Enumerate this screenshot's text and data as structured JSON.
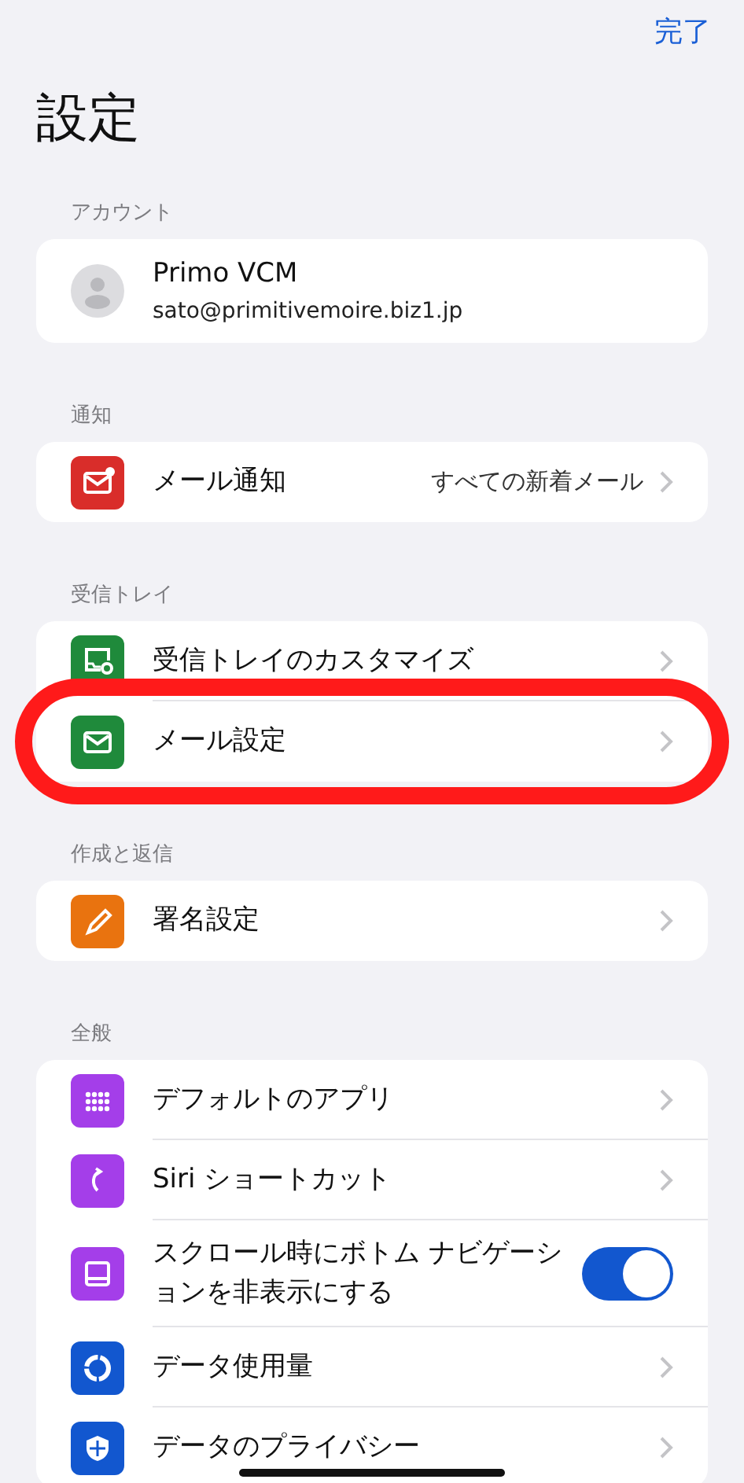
{
  "done_button": "完了",
  "title": "設定",
  "account": {
    "header": "アカウント",
    "name": "Primo VCM",
    "email": "sato@primitivemoire.biz1.jp"
  },
  "sections": [
    {
      "header": "通知",
      "rows": [
        {
          "kind": "link",
          "color": "#d92d2a",
          "label": "メール通知",
          "value": "すべての新着メール",
          "highlighted": false
        }
      ]
    },
    {
      "header": "受信トレイ",
      "rows": [
        {
          "kind": "link",
          "color": "#1f8a3b",
          "label": "受信トレイのカスタマイズ",
          "highlighted": false
        },
        {
          "kind": "link",
          "color": "#1f8a3b",
          "label": "メール設定",
          "highlighted": true
        }
      ]
    },
    {
      "header": "作成と返信",
      "rows": [
        {
          "kind": "link",
          "color": "#e9730f",
          "label": "署名設定",
          "highlighted": false
        }
      ]
    },
    {
      "header": "全般",
      "rows": [
        {
          "kind": "link",
          "color": "#a43ee9",
          "label": "デフォルトのアプリ",
          "highlighted": false
        },
        {
          "kind": "link",
          "color": "#a43ee9",
          "label": "Siri ショートカット",
          "highlighted": false
        },
        {
          "kind": "toggle",
          "color": "#a43ee9",
          "label": "スクロール時にボトム ナビゲーションを非表示にする",
          "on": true,
          "highlighted": false
        },
        {
          "kind": "link",
          "color": "#1257cf",
          "label": "データ使用量",
          "highlighted": false
        },
        {
          "kind": "link",
          "color": "#1257cf",
          "label": "データのプライバシー",
          "highlighted": false
        }
      ]
    }
  ]
}
